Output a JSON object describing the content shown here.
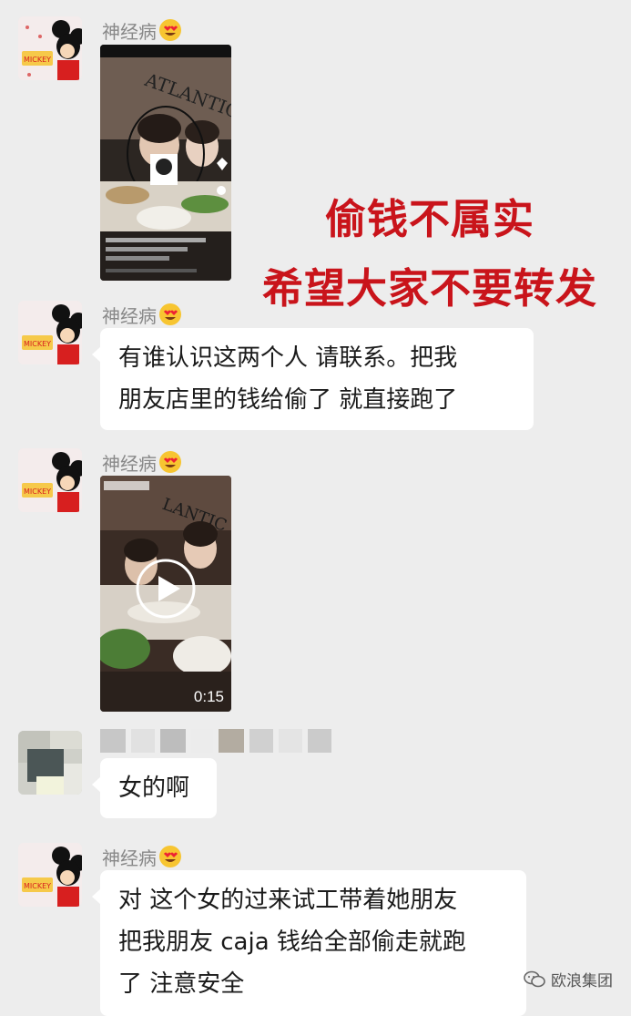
{
  "chat": {
    "sender_name": "神经病",
    "messages": [
      {
        "type": "image",
        "sender": "神经病"
      },
      {
        "type": "text",
        "sender": "神经病",
        "lines": [
          "有谁认识这两个人 请联系。把我",
          "朋友店里的钱给偷了 就直接跑了"
        ]
      },
      {
        "type": "video",
        "sender": "神经病",
        "duration": "0:15"
      },
      {
        "type": "text",
        "sender": "(blurred)",
        "lines": [
          "女的啊"
        ]
      },
      {
        "type": "text",
        "sender": "神经病",
        "lines": [
          "对 这个女的过来试工带着她朋友",
          "把我朋友 caja 钱给全部偷走就跑",
          "了 注意安全"
        ]
      }
    ]
  },
  "overlay": {
    "line1": "偷钱不属实",
    "line2": "希望大家不要转发",
    "color": "#c9141b"
  },
  "watermark": {
    "text": "欧浪集团",
    "icon": "wechat-icon"
  },
  "colors": {
    "background": "#ededed",
    "bubble": "#ffffff",
    "sender_name": "#888888"
  }
}
